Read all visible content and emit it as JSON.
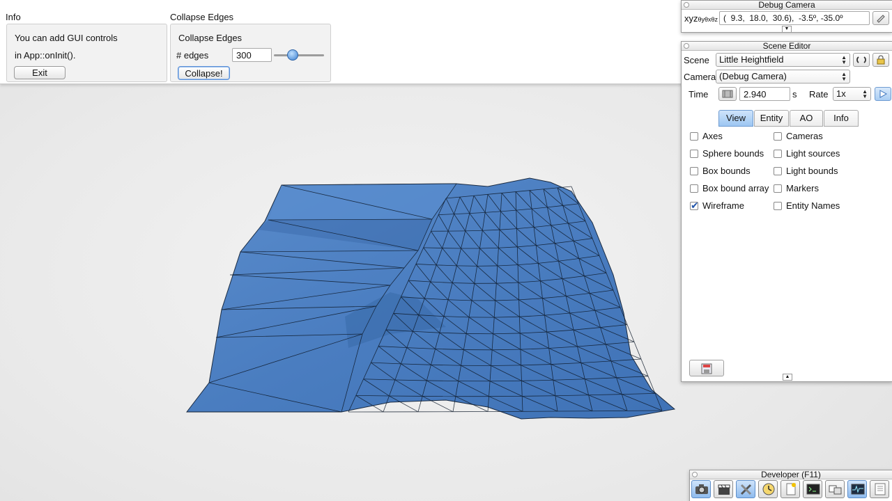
{
  "info_pane": {
    "title": "Info",
    "line1": "You can add GUI controls",
    "line2": "in App::onInit().",
    "exit_label": "Exit"
  },
  "collapse_pane": {
    "title": "Collapse Edges",
    "inner_title": "Collapse Edges",
    "edges_label": "# edges",
    "edges_value": "300",
    "slider_level": 0.36,
    "collapse_label": "Collapse!"
  },
  "debug_camera": {
    "title": "Debug Camera",
    "xyz_label": "xyz",
    "angle_label": "θyθxθz",
    "coords": "(  9.3,  18.0,  30.6),  -3.5º, -35.0º"
  },
  "scene_editor": {
    "title": "Scene Editor",
    "scene_label": "Scene",
    "scene_value": "Little Heightfield",
    "camera_label": "Camera",
    "camera_value": "(Debug Camera)",
    "time_label": "Time",
    "time_value": "2.940",
    "time_unit": "s",
    "rate_label": "Rate",
    "rate_value": "1x",
    "tabs": [
      "View",
      "Entity",
      "AO",
      "Info"
    ],
    "active_tab": "View",
    "checkboxes_left": [
      {
        "label": "Axes",
        "checked": false
      },
      {
        "label": "Sphere bounds",
        "checked": false
      },
      {
        "label": "Box bounds",
        "checked": false
      },
      {
        "label": "Box bound array",
        "checked": false
      },
      {
        "label": "Wireframe",
        "checked": true
      }
    ],
    "checkboxes_right": [
      {
        "label": "Cameras",
        "checked": false
      },
      {
        "label": "Light sources",
        "checked": false
      },
      {
        "label": "Light bounds",
        "checked": false
      },
      {
        "label": "Markers",
        "checked": false
      },
      {
        "label": "Entity Names",
        "checked": false
      }
    ]
  },
  "developer": {
    "title": "Developer (F11)",
    "icons": [
      "camera-icon",
      "clapperboard-icon",
      "tools-icon",
      "clock-icon",
      "new-file-icon",
      "terminal-icon",
      "windows-icon",
      "profiler-icon",
      "document-icon"
    ]
  },
  "colors": {
    "mesh": "#4a7dc0",
    "mesh_dark": "#3a68a8",
    "accent": "#5b8fd6"
  }
}
